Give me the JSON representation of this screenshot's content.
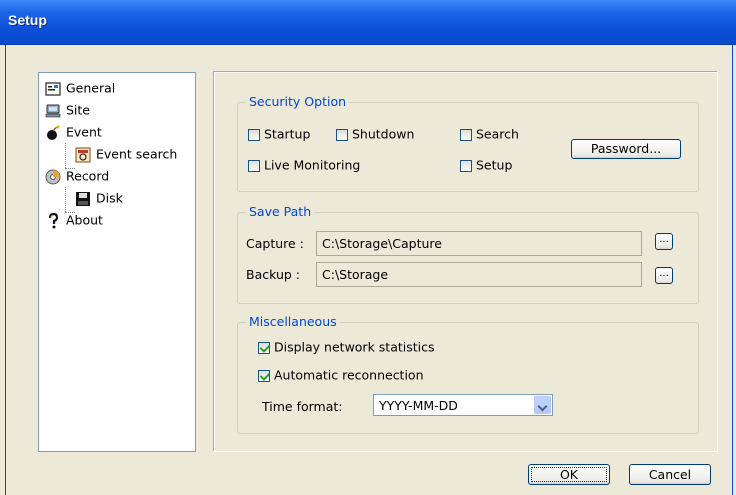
{
  "window": {
    "title": "Setup"
  },
  "tree": {
    "items": [
      {
        "label": "General",
        "icon": "general-icon"
      },
      {
        "label": "Site",
        "icon": "site-icon"
      },
      {
        "label": "Event",
        "icon": "event-icon"
      },
      {
        "label": "Event search",
        "icon": "event-search-icon"
      },
      {
        "label": "Record",
        "icon": "record-icon"
      },
      {
        "label": "Disk",
        "icon": "disk-icon"
      },
      {
        "label": "About",
        "icon": "about-icon"
      }
    ]
  },
  "security": {
    "title": "Security Option",
    "startup": {
      "label": "Startup",
      "checked": false
    },
    "shutdown": {
      "label": "Shutdown",
      "checked": false
    },
    "search": {
      "label": "Search",
      "checked": false
    },
    "live": {
      "label": "Live Monitoring",
      "checked": false
    },
    "setup": {
      "label": "Setup",
      "checked": false
    },
    "password_button": "Password..."
  },
  "save_path": {
    "title": "Save Path",
    "capture_label": "Capture :",
    "capture_value": "C:\\Storage\\Capture",
    "backup_label": "Backup :",
    "backup_value": "C:\\Storage",
    "browse_label": "..."
  },
  "misc": {
    "title": "Miscellaneous",
    "network_stats": {
      "label": "Display network statistics",
      "checked": true
    },
    "auto_reconnect": {
      "label": "Automatic reconnection",
      "checked": true
    },
    "time_format_label": "Time format:",
    "time_format_value": "YYYY-MM-DD"
  },
  "buttons": {
    "ok": "OK",
    "cancel": "Cancel"
  }
}
